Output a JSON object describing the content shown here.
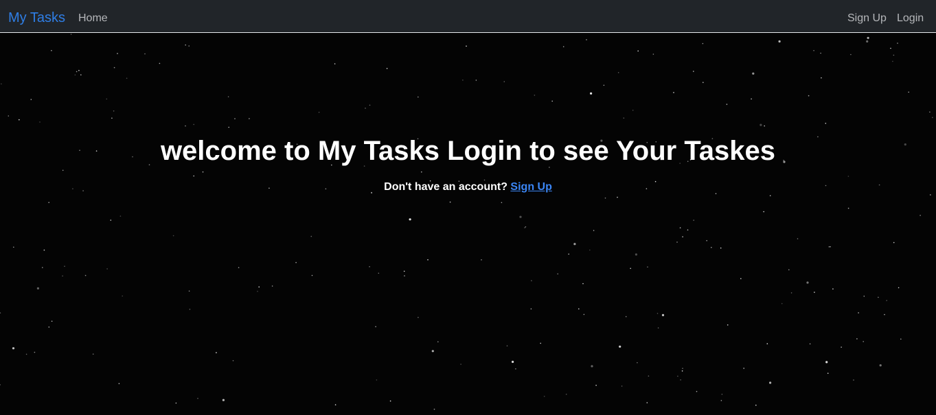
{
  "navbar": {
    "brand": "My Tasks",
    "links": {
      "home": "Home",
      "signup": "Sign Up",
      "login": "Login"
    }
  },
  "main": {
    "heading": "welcome to My Tasks Login to see Your Taskes",
    "account_prompt": "Don't have an account? ",
    "signup_link": "Sign Up"
  },
  "colors": {
    "navbar_bg": "#212529",
    "brand": "#2f7ee5",
    "link": "#3b86f5",
    "background": "#040404"
  }
}
